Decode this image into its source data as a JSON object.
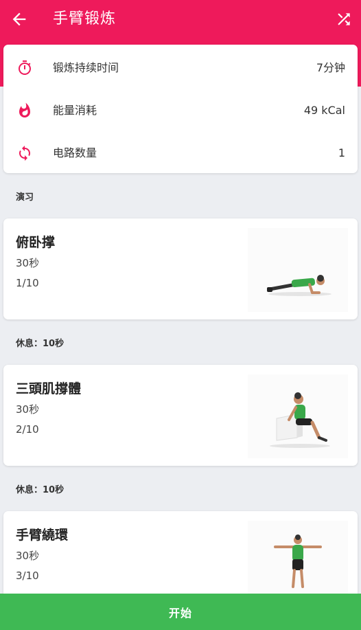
{
  "header": {
    "title": "手臂锻炼"
  },
  "summary": [
    {
      "icon": "stopwatch-icon",
      "label": "锻炼持续时间",
      "value": "7分钟"
    },
    {
      "icon": "flame-icon",
      "label": "能量消耗",
      "value": "49 kCal"
    },
    {
      "icon": "repeat-icon",
      "label": "电路数量",
      "value": "1"
    }
  ],
  "section_label": "演习",
  "exercises": [
    {
      "name": "俯卧撑",
      "duration": "30秒",
      "index": "1/10"
    },
    {
      "name": "三頭肌撐體",
      "duration": "30秒",
      "index": "2/10"
    },
    {
      "name": "手臂繞環",
      "duration": "30秒",
      "index": "3/10"
    }
  ],
  "rests": [
    {
      "label": "休息：",
      "value": "10秒"
    },
    {
      "label": "休息：",
      "value": "10秒"
    }
  ],
  "start_label": "开始",
  "colors": {
    "accent": "#ee1a5b",
    "start": "#3fb954",
    "background": "#eceef2"
  }
}
